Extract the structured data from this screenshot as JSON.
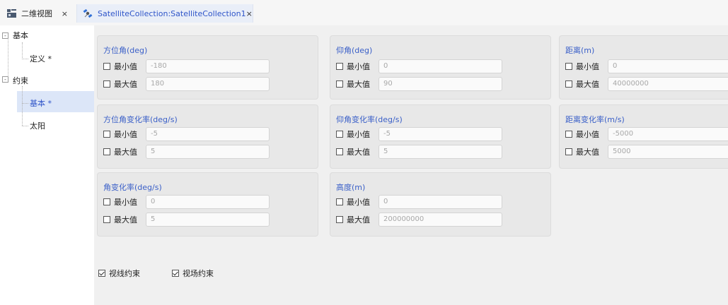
{
  "tabs": [
    {
      "label": "二维视图",
      "close": "×",
      "icon": "map-view-icon"
    },
    {
      "label": "SatelliteCollection:SatelliteCollection1",
      "close": "×",
      "icon": "satellite-icon"
    }
  ],
  "tree": {
    "nodes": [
      {
        "label": "基本",
        "expander": "-"
      },
      {
        "label": "定义 *"
      },
      {
        "label": "约束",
        "expander": "-"
      },
      {
        "label": "基本 *",
        "selected": true
      },
      {
        "label": "太阳"
      }
    ]
  },
  "groups": [
    {
      "title": "方位角(deg)",
      "min_label": "最小值",
      "min_value": "-180",
      "max_label": "最大值",
      "max_value": "180"
    },
    {
      "title": "仰角(deg)",
      "min_label": "最小值",
      "min_value": "0",
      "max_label": "最大值",
      "max_value": "90"
    },
    {
      "title": "距离(m)",
      "min_label": "最小值",
      "min_value": "0",
      "max_label": "最大值",
      "max_value": "40000000"
    },
    {
      "title": "方位角变化率(deg/s)",
      "min_label": "最小值",
      "min_value": "-5",
      "max_label": "最大值",
      "max_value": "5"
    },
    {
      "title": "仰角变化率(deg/s)",
      "min_label": "最小值",
      "min_value": "-5",
      "max_label": "最大值",
      "max_value": "5"
    },
    {
      "title": "距离变化率(m/s)",
      "min_label": "最小值",
      "min_value": "-5000",
      "max_label": "最大值",
      "max_value": "5000"
    },
    {
      "title": "角变化率(deg/s)",
      "min_label": "最小值",
      "min_value": "0",
      "max_label": "最大值",
      "max_value": "5"
    },
    {
      "title": "高度(m)",
      "min_label": "最小值",
      "min_value": "0",
      "max_label": "最大值",
      "max_value": "200000000"
    }
  ],
  "bottom": {
    "line_of_sight_label": "视线约束",
    "field_of_view_label": "视场约束"
  },
  "colors": {
    "accent": "#3b60c8",
    "selected_bg": "#dce6f8",
    "panel_bg": "#e8e8e8"
  }
}
